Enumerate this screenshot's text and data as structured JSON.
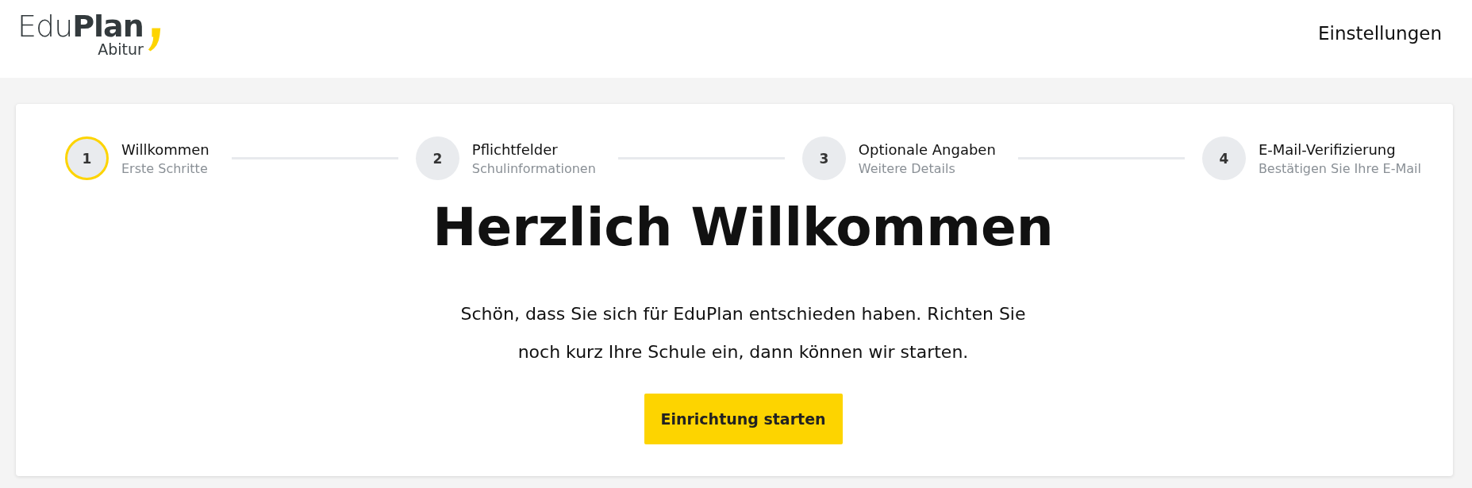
{
  "header": {
    "logo": {
      "first": "Edu",
      "second": "Plan",
      "subtitle": "Abitur"
    },
    "settings_link": "Einstellungen"
  },
  "steps": [
    {
      "number": "1",
      "title": "Willkommen",
      "subtitle": "Erste Schritte",
      "selected": true
    },
    {
      "number": "2",
      "title": "Pflichtfelder",
      "subtitle": "Schulinformationen",
      "selected": false
    },
    {
      "number": "3",
      "title": "Optionale Angaben",
      "subtitle": "Weitere Details",
      "selected": false
    },
    {
      "number": "4",
      "title": "E-Mail-Verifizierung",
      "subtitle": "Bestätigen Sie Ihre E-Mail",
      "selected": false
    }
  ],
  "heading": "Herzlich Willkommen",
  "intro": "Schön, dass Sie sich für EduPlan entschieden haben. Richten Sie noch kurz Ihre Schule ein, dann können wir starten.",
  "start_button": "Einrichtung starten"
}
